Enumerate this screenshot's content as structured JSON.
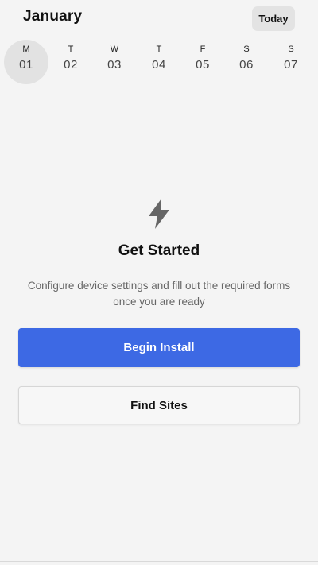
{
  "header": {
    "month": "January",
    "today_label": "Today"
  },
  "week": {
    "days": [
      {
        "dow": "M",
        "num": "01",
        "selected": true
      },
      {
        "dow": "T",
        "num": "02",
        "selected": false
      },
      {
        "dow": "W",
        "num": "03",
        "selected": false
      },
      {
        "dow": "T",
        "num": "04",
        "selected": false
      },
      {
        "dow": "F",
        "num": "05",
        "selected": false
      },
      {
        "dow": "S",
        "num": "06",
        "selected": false
      },
      {
        "dow": "S",
        "num": "07",
        "selected": false
      }
    ]
  },
  "empty_state": {
    "icon": "lightning-bolt-icon",
    "title": "Get Started",
    "description": "Configure device settings and fill out the required forms once you are ready"
  },
  "actions": {
    "primary_label": "Begin Install",
    "secondary_label": "Find Sites"
  },
  "colors": {
    "primary": "#3d69e4",
    "background": "#f4f4f4",
    "selected_day": "#e2e2e2",
    "icon": "#666666"
  }
}
